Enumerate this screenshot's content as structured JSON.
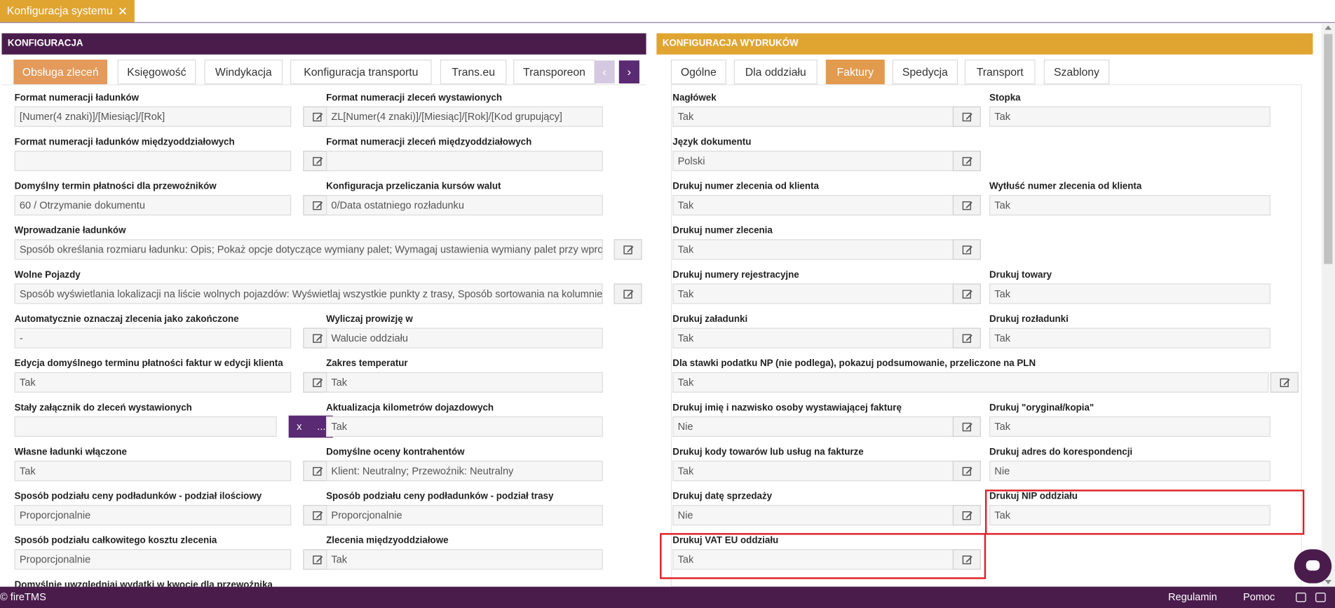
{
  "doc_tab": {
    "label": "Konfiguracja systemu",
    "close": "✕"
  },
  "left_panel": {
    "title": "KONFIGURACJA",
    "tabs": [
      "Obsługa zleceń",
      "Księgowość",
      "Windykacja",
      "Konfiguracja transportu",
      "Trans.eu",
      "Transporeon"
    ],
    "nav_prev": "‹",
    "nav_next": "›",
    "fields": [
      {
        "label": "Format numeracji ładunków",
        "value": "[Numer(4 znaki)]/[Miesiąc]/[Rok]"
      },
      {
        "label": "Format numeracji zleceń wystawionych",
        "value": "ZL[Numer(4 znaki)]/[Miesiąc]/[Rok]/[Kod grupujący]"
      },
      {
        "label": "Format numeracji ładunków międzyoddziałowych",
        "value": ""
      },
      {
        "label": "Format numeracji zleceń międzyoddziałowych",
        "value": ""
      },
      {
        "label": "Domyślny termin płatności dla przewoźników",
        "value": "60 / Otrzymanie dokumentu"
      },
      {
        "label": "Konfiguracja przeliczania kursów walut",
        "value": "0/Data ostatniego rozładunku"
      },
      {
        "label": "Wprowadzanie ładunków",
        "value": "Sposób określania rozmiaru ładunku: Opis; Pokaż opcje dotyczące wymiany palet; Wymagaj ustawienia wymiany palet przy wprowadzaniu"
      },
      {
        "label": "Wolne Pojazdy",
        "value": "Sposób wyświetlania lokalizacji na liście wolnych pojazdów: Wyświetlaj wszystkie punkty z trasy, Sposób sortowania na kolumnie lokalizacji"
      },
      {
        "label": "Automatycznie oznaczaj zlecenia jako zakończone",
        "value": "-"
      },
      {
        "label": "Wyliczaj prowizję w",
        "value": "Walucie oddziału"
      },
      {
        "label": "Edycja domyślnego terminu płatności faktur w edycji klienta",
        "value": "Tak"
      },
      {
        "label": "Zakres temperatur",
        "value": "Tak"
      },
      {
        "label": "Stały załącznik do zleceń wystawionych",
        "value": "",
        "btn_x": "x",
        "btn_more": "..."
      },
      {
        "label": "Aktualizacja kilometrów dojazdowych",
        "value": "Tak"
      },
      {
        "label": "Własne ładunki włączone",
        "value": "Tak"
      },
      {
        "label": "Domyślne oceny kontrahentów",
        "value": "Klient: Neutralny; Przewoźnik: Neutralny"
      },
      {
        "label": "Sposób podziału ceny podładunków - podział ilościowy",
        "value": "Proporcjonalnie"
      },
      {
        "label": "Sposób podziału ceny podładunków - podział trasy",
        "value": "Proporcjonalnie"
      },
      {
        "label": "Sposób podziału całkowitego kosztu zlecenia",
        "value": "Proporcjonalnie"
      },
      {
        "label": "Zlecenia międzyoddziałowe",
        "value": "Tak"
      },
      {
        "label": "Domyślnie uwzględniaj wydatki w kwocie dla przewoźnika",
        "value": ""
      }
    ]
  },
  "right_panel": {
    "title": "KONFIGURACJA WYDRUKÓW",
    "tabs": [
      "Ogólne",
      "Dla oddziału",
      "Faktury",
      "Spedycja",
      "Transport",
      "Szablony"
    ],
    "fields": [
      {
        "label": "Nagłówek",
        "value": "Tak"
      },
      {
        "label": "Stopka",
        "value": "Tak"
      },
      {
        "label": "Język dokumentu",
        "value": "Polski"
      },
      {
        "label": "Drukuj numer zlecenia od klienta",
        "value": "Tak"
      },
      {
        "label": "Wytłuść numer zlecenia od klienta",
        "value": "Tak"
      },
      {
        "label": "Drukuj numer zlecenia",
        "value": "Tak"
      },
      {
        "label": "Drukuj numery rejestracyjne",
        "value": "Tak"
      },
      {
        "label": "Drukuj towary",
        "value": "Tak"
      },
      {
        "label": "Drukuj załadunki",
        "value": "Tak"
      },
      {
        "label": "Drukuj rozładunki",
        "value": "Tak"
      },
      {
        "label": "Dla stawki podatku NP (nie podlega), pokazuj podsumowanie, przeliczone na PLN",
        "value": "Tak"
      },
      {
        "label": "Drukuj imię i nazwisko osoby wystawiającej fakturę",
        "value": "Nie"
      },
      {
        "label": "Drukuj \"oryginał/kopia\"",
        "value": "Tak"
      },
      {
        "label": "Drukuj kody towarów lub usług na fakturze",
        "value": "Tak"
      },
      {
        "label": "Drukuj adres do korespondencji",
        "value": "Nie"
      },
      {
        "label": "Drukuj datę sprzedaży",
        "value": "Nie"
      },
      {
        "label": "Drukuj NIP oddziału",
        "value": "Tak"
      },
      {
        "label": "Drukuj VAT EU oddziału",
        "value": "Tak"
      }
    ]
  },
  "footer": {
    "brand": "© fireTMS",
    "terms": "Regulamin",
    "help": "Pomoc"
  },
  "colors": {
    "purple": "#4a1c4c",
    "amber": "#e0a531",
    "orange_tab": "#e39a5a",
    "highlight": "#e01e26"
  }
}
